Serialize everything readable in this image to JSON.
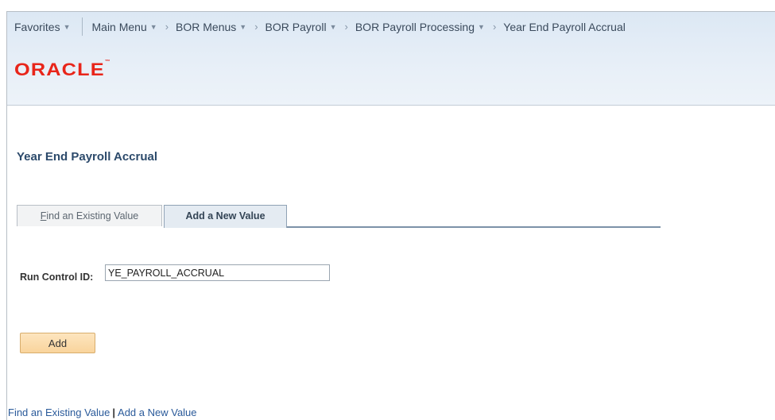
{
  "navbar": {
    "favorites": "Favorites",
    "main_menu": "Main Menu",
    "breadcrumbs": [
      "BOR Menus",
      "BOR Payroll",
      "BOR Payroll Processing",
      "Year End Payroll Accrual"
    ]
  },
  "logo": {
    "text": "ORACLE"
  },
  "page": {
    "title": "Year End Payroll Accrual"
  },
  "tabs": {
    "find_first_letter": "F",
    "find_rest": "ind an Existing Value",
    "add": "Add a New Value"
  },
  "form": {
    "run_control_label": "Run Control ID:",
    "run_control_value": "YE_PAYROLL_ACCRUAL"
  },
  "buttons": {
    "add": "Add"
  },
  "bottom_links": {
    "find": "Find an Existing Value",
    "separator": "|",
    "add": "Add a New Value"
  },
  "colors": {
    "logo_red": "#e8251a",
    "title_blue": "#2c4a6b",
    "add_button": "#f9d49c",
    "link_blue": "#2a5a9a"
  },
  "icons": {
    "dropdown": "chevron-down-icon",
    "breadcrumb_separator": "chevron-right-icon"
  }
}
